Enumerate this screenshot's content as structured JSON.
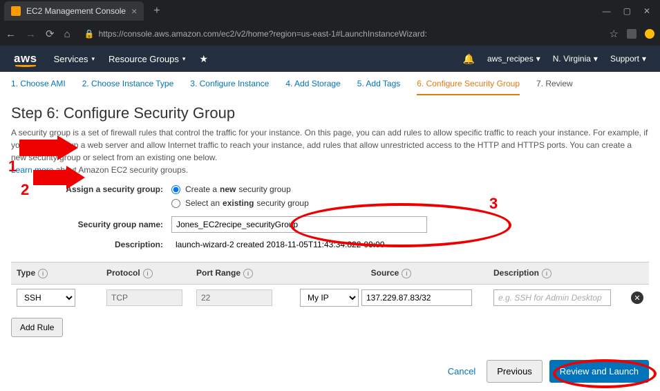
{
  "browser": {
    "tab_title": "EC2 Management Console",
    "url": "https://console.aws.amazon.com/ec2/v2/home?region=us-east-1#LaunchInstanceWizard:"
  },
  "aws_nav": {
    "logo": "aws",
    "services": "Services",
    "resource_groups": "Resource Groups",
    "account": "aws_recipes",
    "region": "N. Virginia",
    "support": "Support"
  },
  "wizard_tabs": [
    "1. Choose AMI",
    "2. Choose Instance Type",
    "3. Configure Instance",
    "4. Add Storage",
    "5. Add Tags",
    "6. Configure Security Group",
    "7. Review"
  ],
  "active_tab_index": 5,
  "step": {
    "title": "Step 6: Configure Security Group",
    "desc_part1": "A security group is a set of firewall rules that control the traffic for your instance. On this page, you can add rules to allow specific traffic to reach your instance. For example, if you want to set up a web server and allow Internet traffic to reach your instance, add rules that allow unrestricted access to the HTTP and HTTPS ports. You can create a new security group or select from an existing one below.",
    "learn_more": "Learn more",
    "desc_part2": " about Amazon EC2 security groups."
  },
  "form": {
    "assign_label": "Assign a security group:",
    "option_new_prefix": "Create a ",
    "option_new_bold": "new",
    "option_new_suffix": " security group",
    "option_existing_prefix": "Select an ",
    "option_existing_bold": "existing",
    "option_existing_suffix": " security group",
    "sg_name_label": "Security group name:",
    "sg_name_value": "Jones_EC2recipe_securityGroup",
    "desc_label": "Description:",
    "desc_value": "launch-wizard-2 created 2018-11-05T11:43:34.822-09:00"
  },
  "rules_table": {
    "headers": {
      "type": "Type",
      "protocol": "Protocol",
      "port_range": "Port Range",
      "source": "Source",
      "description": "Description"
    },
    "rows": [
      {
        "type": "SSH",
        "protocol": "TCP",
        "port_range": "22",
        "source_mode": "My IP",
        "source_ip": "137.229.87.83/32",
        "description": "",
        "description_placeholder": "e.g. SSH for Admin Desktop"
      }
    ],
    "add_rule": "Add Rule"
  },
  "footer": {
    "cancel": "Cancel",
    "previous": "Previous",
    "review": "Review and Launch"
  },
  "annotations": {
    "n1": "1",
    "n2": "2",
    "n3": "3"
  }
}
